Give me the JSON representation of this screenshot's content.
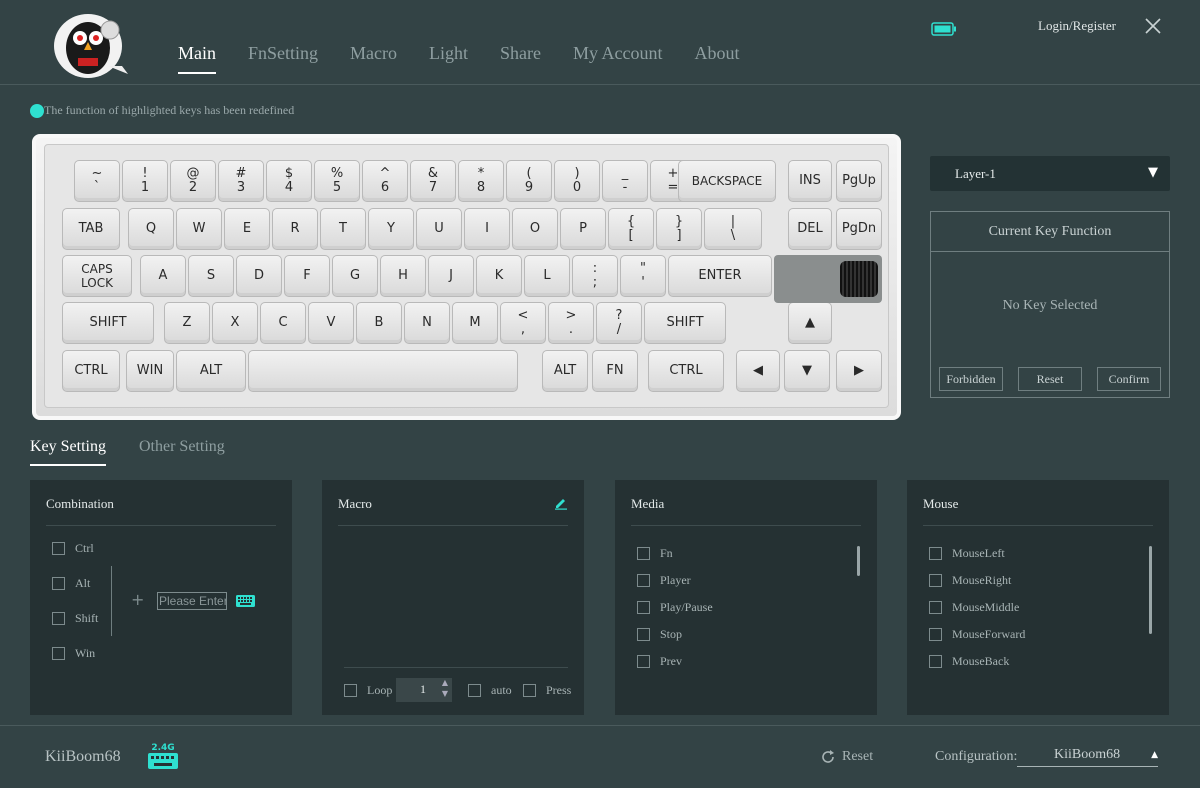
{
  "nav": {
    "items": [
      "Main",
      "FnSetting",
      "Macro",
      "Light",
      "Share",
      "My Account",
      "About"
    ],
    "active": "Main"
  },
  "header": {
    "login": "Login/Register"
  },
  "icons": {
    "logo": "owl-mascot-logo",
    "battery": "battery-icon",
    "close": "close-icon"
  },
  "colors": {
    "accent": "#2fe0d0",
    "background": "#334345",
    "panel": "#253133"
  },
  "notice": "The function of highlighted keys has been redefined",
  "keyboard": {
    "row1": [
      "~\n`",
      "!\n1",
      "@\n2",
      "#\n3",
      "$\n4",
      "%\n5",
      "^\n6",
      "&\n7",
      "*\n8",
      "(\n9",
      ")\n0",
      "_\n-",
      "+\n=",
      "BACKSPACE",
      "INS",
      "PgUp"
    ],
    "row2": [
      "TAB",
      "Q",
      "W",
      "E",
      "R",
      "T",
      "Y",
      "U",
      "I",
      "O",
      "P",
      "{\n[",
      "}\n]",
      "|\n\\",
      "DEL",
      "PgDn"
    ],
    "row3": [
      "CAPS\nLOCK",
      "A",
      "S",
      "D",
      "F",
      "G",
      "H",
      "J",
      "K",
      "L",
      ":\n;",
      "\"\n'",
      "ENTER"
    ],
    "row4": [
      "SHIFT",
      "Z",
      "X",
      "C",
      "V",
      "B",
      "N",
      "M",
      "<\n,",
      ">\n.",
      "?\n/",
      "SHIFT",
      "▲"
    ],
    "row5": [
      "CTRL",
      "WIN",
      "ALT",
      "",
      "ALT",
      "FN",
      "CTRL",
      "◀",
      "▼",
      "▶"
    ]
  },
  "layer": {
    "selected": "Layer-1"
  },
  "key_function": {
    "title": "Current Key Function",
    "empty": "No Key Selected",
    "buttons": [
      "Forbidden",
      "Reset",
      "Confirm"
    ]
  },
  "tabs": [
    "Key Setting",
    "Other Setting"
  ],
  "combination": {
    "title": "Combination",
    "modifiers": [
      "Ctrl",
      "Alt",
      "Shift",
      "Win"
    ],
    "plus": "+",
    "input_placeholder": "Please Enter"
  },
  "macro": {
    "title": "Macro",
    "loop_label": "Loop",
    "loop_value": "1",
    "auto_label": "auto",
    "press_label": "Press"
  },
  "media": {
    "title": "Media",
    "items": [
      "Fn",
      "Player",
      "Play/Pause",
      "Stop",
      "Prev"
    ]
  },
  "mouse": {
    "title": "Mouse",
    "items": [
      "MouseLeft",
      "MouseRight",
      "MouseMiddle",
      "MouseForward",
      "MouseBack"
    ]
  },
  "footer": {
    "device": "KiiBoom68",
    "dongle_label": "2.4G",
    "reset": "Reset",
    "config_label": "Configuration:",
    "config_value": "KiiBoom68"
  }
}
